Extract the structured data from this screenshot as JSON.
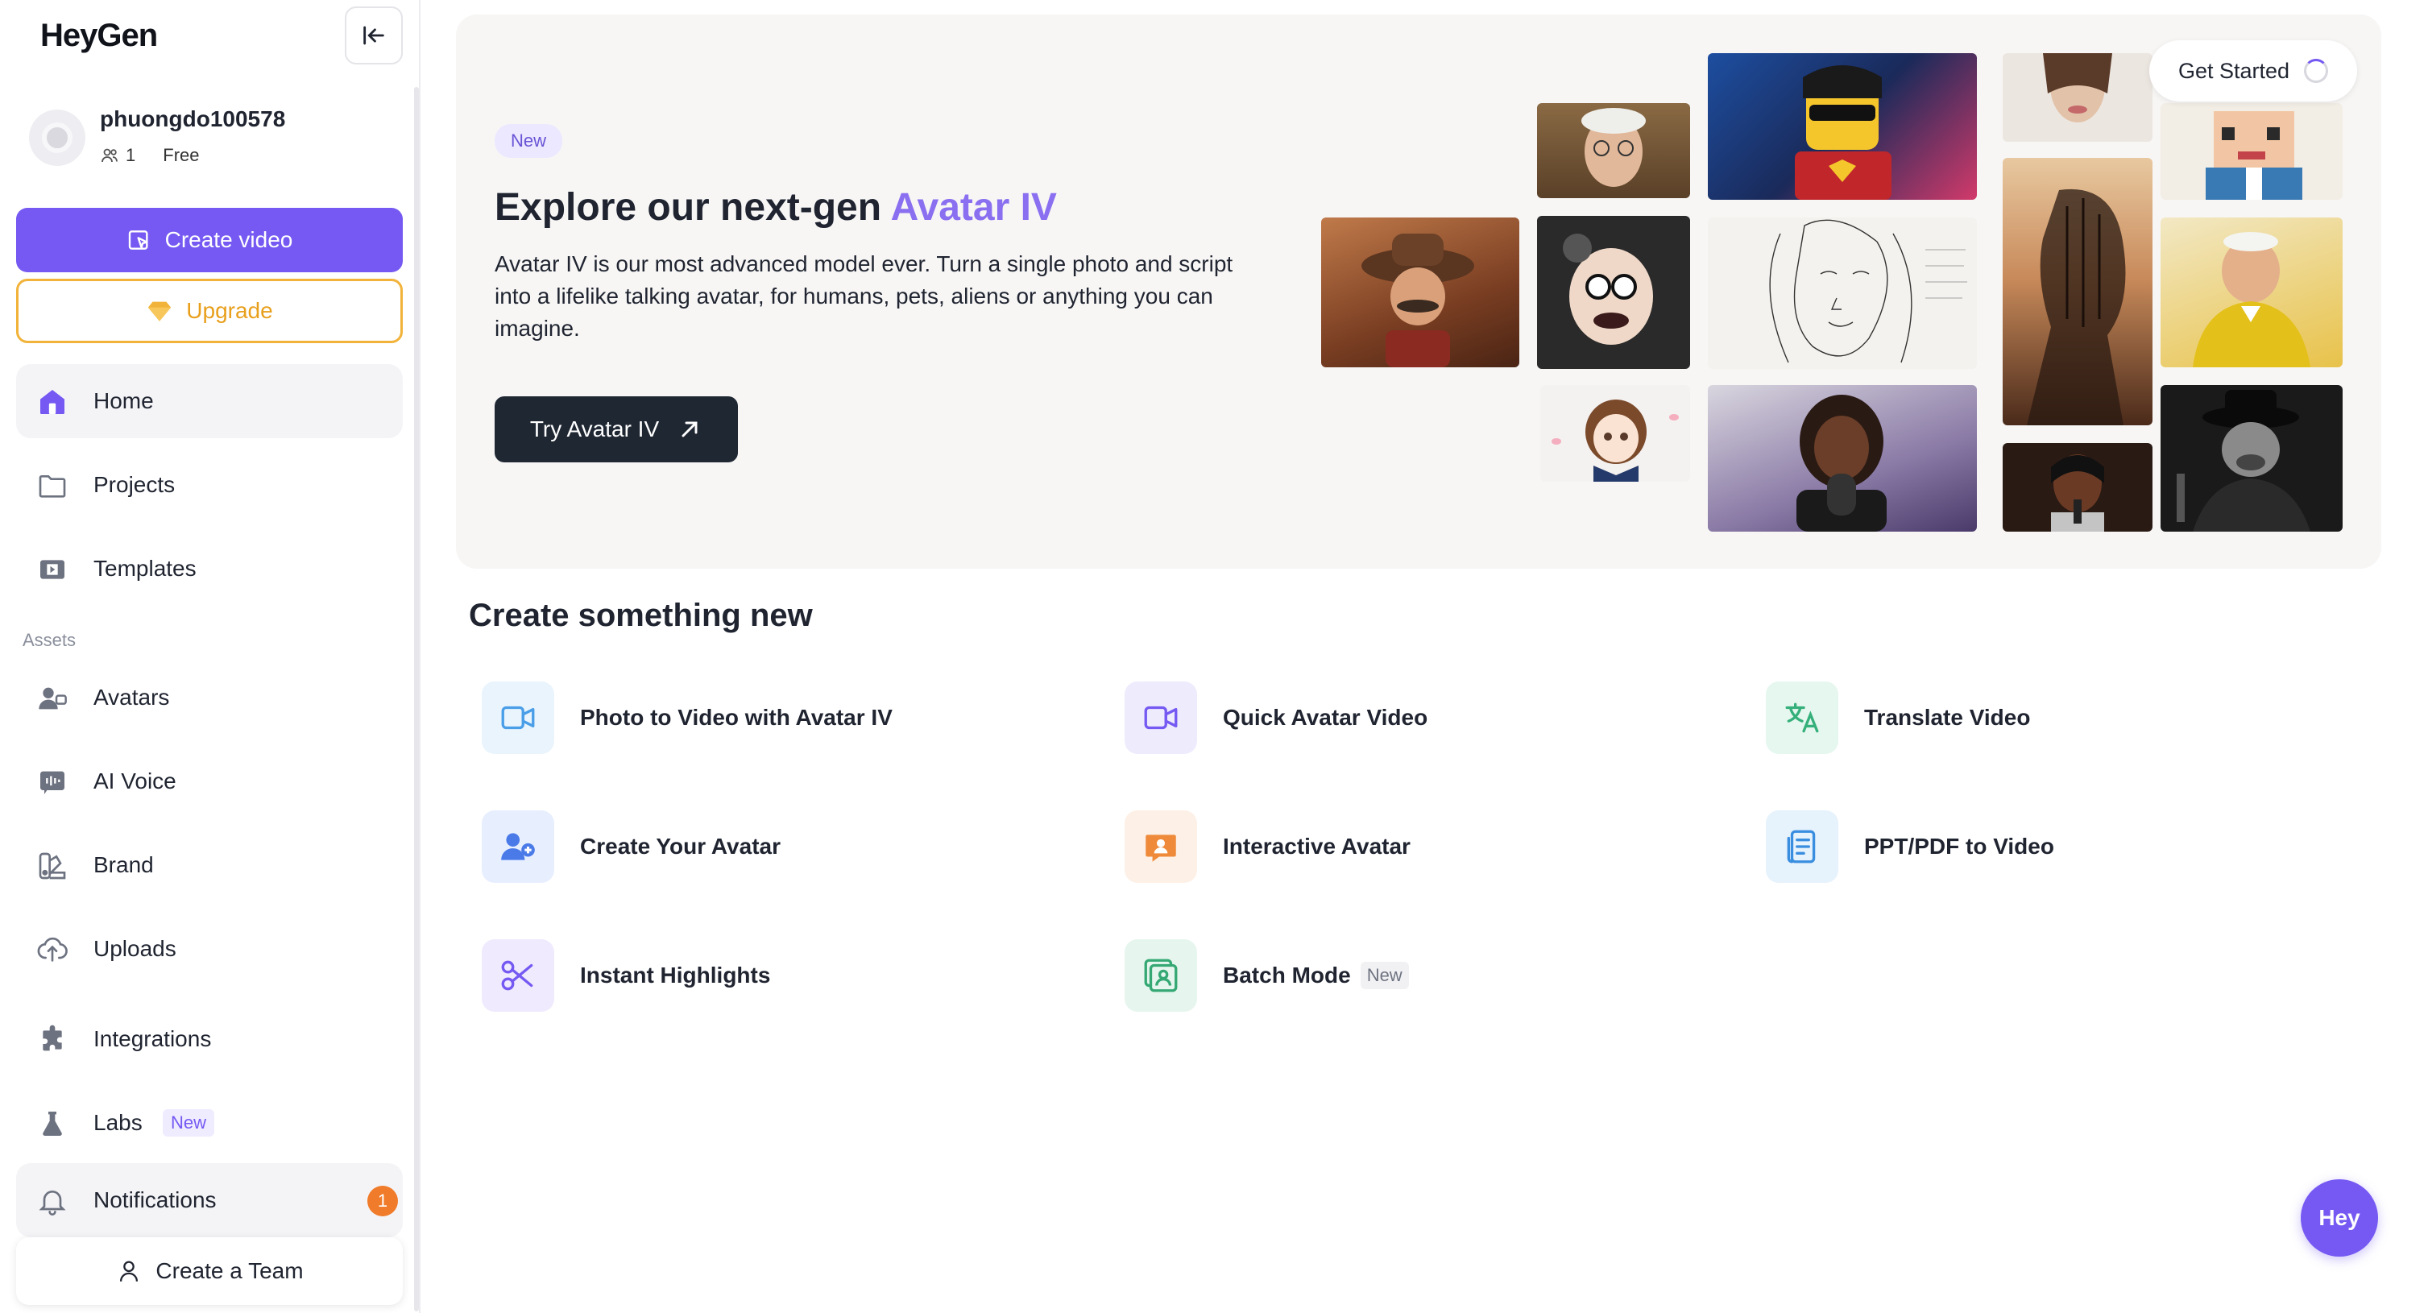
{
  "app": {
    "logo_text": "HeyGen"
  },
  "user": {
    "name": "phuongdo100578",
    "members": "1",
    "plan": "Free"
  },
  "sidebar": {
    "create_video_label": "Create video",
    "upgrade_label": "Upgrade",
    "assets_heading": "Assets",
    "items": [
      {
        "label": "Home",
        "icon": "home-icon"
      },
      {
        "label": "Projects",
        "icon": "folder-icon"
      },
      {
        "label": "Templates",
        "icon": "film-icon"
      },
      {
        "label": "Avatars",
        "icon": "avatar-icon"
      },
      {
        "label": "AI Voice",
        "icon": "voice-icon"
      },
      {
        "label": "Brand",
        "icon": "brand-icon"
      },
      {
        "label": "Uploads",
        "icon": "upload-icon"
      },
      {
        "label": "Integrations",
        "icon": "puzzle-icon"
      },
      {
        "label": "Labs",
        "icon": "flask-icon",
        "tag": "New"
      },
      {
        "label": "Notifications",
        "icon": "bell-icon",
        "badge": "1"
      }
    ],
    "create_team_label": "Create a Team"
  },
  "hero": {
    "tag": "New",
    "title_prefix": "Explore our next-gen ",
    "title_accent": "Avatar IV",
    "description": "Avatar IV is our most advanced model ever. Turn a single photo and script into a lifelike talking avatar, for humans, pets, aliens or anything you can imagine.",
    "button_label": "Try Avatar IV",
    "get_started_label": "Get Started"
  },
  "create": {
    "title": "Create something new",
    "cards": [
      {
        "label": "Photo to Video with Avatar IV",
        "icon": "video-camera-icon"
      },
      {
        "label": "Quick Avatar Video",
        "icon": "video-camera-icon"
      },
      {
        "label": "Translate Video",
        "icon": "translate-icon"
      },
      {
        "label": "Create Your Avatar",
        "icon": "add-user-icon"
      },
      {
        "label": "Interactive Avatar",
        "icon": "chat-avatar-icon"
      },
      {
        "label": "PPT/PDF to Video",
        "icon": "document-icon"
      },
      {
        "label": "Instant Highlights",
        "icon": "scissors-icon"
      },
      {
        "label": "Batch Mode",
        "icon": "batch-icon",
        "tag": "New"
      }
    ]
  },
  "fab": {
    "label": "Hey"
  },
  "colors": {
    "brand": "#7559f2",
    "upgrade": "#f2b33a",
    "notification": "#f07b2a",
    "hero_bg": "#f7f6f5"
  }
}
